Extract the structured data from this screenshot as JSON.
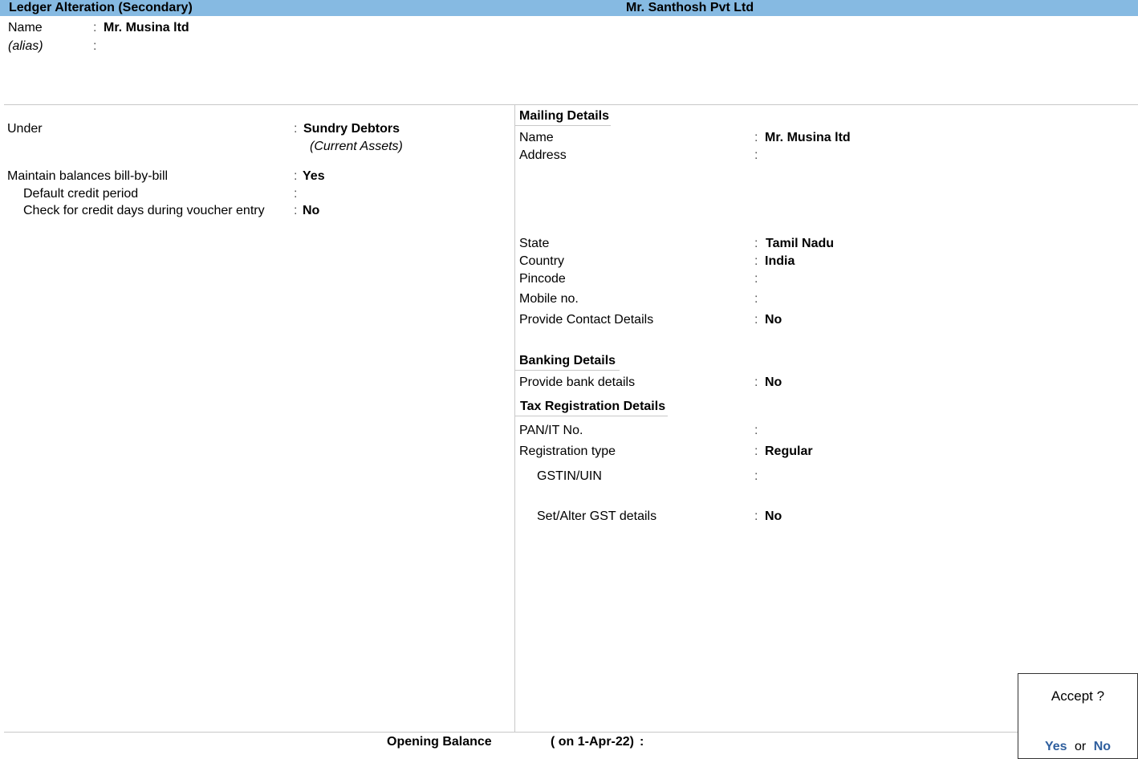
{
  "titlebar": {
    "screen_title": "Ledger Alteration (Secondary)",
    "company": "Mr. Santhosh Pvt Ltd"
  },
  "header": {
    "name_label": "Name",
    "name_value": "Mr. Musina ltd",
    "alias_label": "(alias)",
    "alias_value": ""
  },
  "left": {
    "under_label": "Under",
    "under_value": "Sundry Debtors",
    "under_parent": "(Current Assets)",
    "bill_label": "Maintain balances bill-by-bill",
    "bill_value": "Yes",
    "credit_period_label": "Default credit period",
    "credit_period_value": "",
    "check_credit_label": "Check for credit days during voucher entry",
    "check_credit_value": "No"
  },
  "mailing": {
    "heading": "Mailing Details",
    "name_label": "Name",
    "name_value": "Mr. Musina ltd",
    "address_label": "Address",
    "address_value": "",
    "state_label": "State",
    "state_value": "Tamil Nadu",
    "country_label": "Country",
    "country_value": "India",
    "pincode_label": "Pincode",
    "pincode_value": "",
    "mobile_label": "Mobile no.",
    "mobile_value": "",
    "contact_label": "Provide Contact Details",
    "contact_value": "No"
  },
  "banking": {
    "heading": "Banking Details",
    "bank_label": "Provide bank details",
    "bank_value": "No"
  },
  "tax": {
    "heading": "Tax Registration Details",
    "pan_label": "PAN/IT No.",
    "pan_value": "",
    "regtype_label": "Registration type",
    "regtype_value": "Regular",
    "gstin_label": "GSTIN/UIN",
    "gstin_value": "",
    "gst_details_label": "Set/Alter GST details",
    "gst_details_value": "No"
  },
  "footer": {
    "opening_label": "Opening Balance",
    "opening_date": "( on 1-Apr-22)",
    "opening_colon": ":",
    "opening_value": ""
  },
  "dialog": {
    "question": "Accept ?",
    "yes": "Yes",
    "or": "or",
    "no": "No"
  },
  "colon": ":"
}
